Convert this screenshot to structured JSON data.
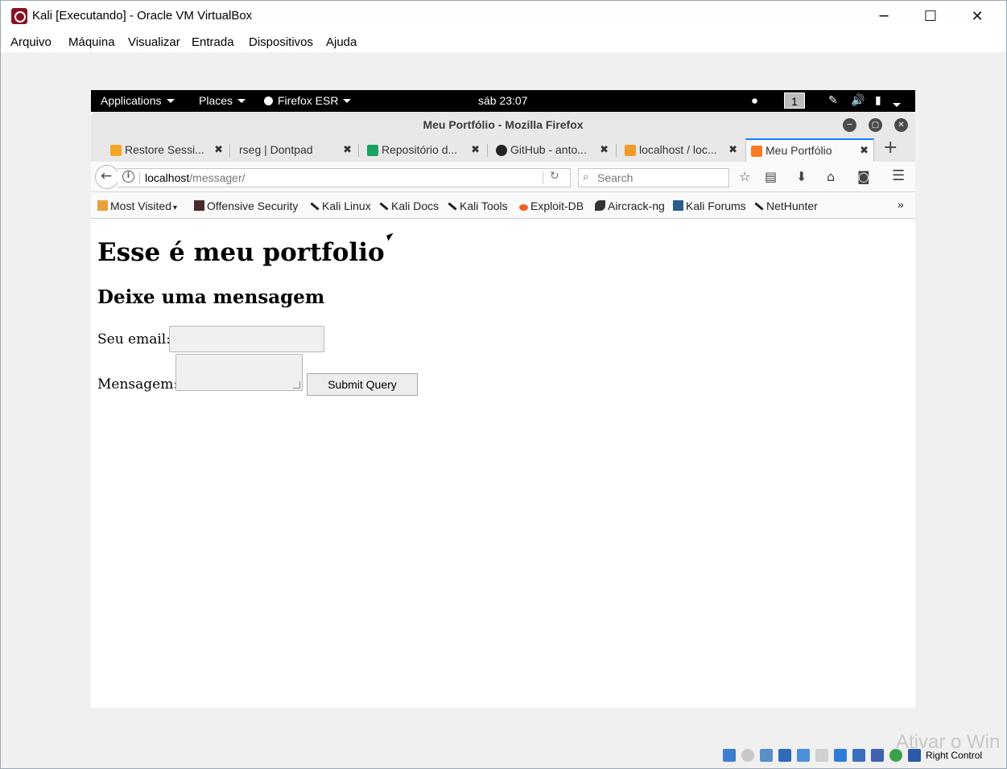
{
  "vbox": {
    "title": "Kali [Executando] - Oracle VM VirtualBox",
    "minimize": "─",
    "maximize": "☐",
    "close": "✕",
    "menu": [
      "Arquivo",
      "Máquina",
      "Visualizar",
      "Entrada",
      "Dispositivos",
      "Ajuda"
    ],
    "status_host_key": "Right Control",
    "watermark": "Ativar o Win"
  },
  "gnome": {
    "applications": "Applications",
    "places": "Places",
    "firefox": "Firefox ESR",
    "clock": "sáb 23:07",
    "workspace": "1"
  },
  "firefox": {
    "window_title": "Meu Portfólio - Mozilla Firefox",
    "tabs": [
      {
        "label": "Restore Sessi...",
        "icon_color": "#f5a623"
      },
      {
        "label": "rseg | Dontpad",
        "icon_color": ""
      },
      {
        "label": "Repositório d...",
        "icon_color": "#1aa260"
      },
      {
        "label": "GitHub - anto...",
        "icon_color": "#222222"
      },
      {
        "label": "localhost / loc...",
        "icon_color": "#f09a2b"
      },
      {
        "label": "Meu Portfólio",
        "icon_color": "#fb7a24"
      }
    ],
    "url_host": "localhost",
    "url_path": "/messager/",
    "search_placeholder": "Search",
    "bookmarks": [
      {
        "label": "Most Visited",
        "icon_color": "#e9a03b"
      },
      {
        "label": "Offensive Security",
        "icon_color": "#4a2b2b"
      },
      {
        "label": "Kali Linux",
        "icon_color": "#222"
      },
      {
        "label": "Kali Docs",
        "icon_color": "#222"
      },
      {
        "label": "Kali Tools",
        "icon_color": "#222"
      },
      {
        "label": "Exploit-DB",
        "icon_color": "#f06022"
      },
      {
        "label": "Aircrack-ng",
        "icon_color": "#333"
      },
      {
        "label": "Kali Forums",
        "icon_color": "#2b5d8c"
      },
      {
        "label": "NetHunter",
        "icon_color": "#222"
      }
    ],
    "bookmarks_overflow": "»"
  },
  "page": {
    "heading": "Esse é meu portfolio",
    "subheading": "Deixe uma mensagem",
    "email_label": "Seu email:",
    "email_value": "",
    "message_label": "Mensagem:",
    "message_value": "",
    "submit_label": "Submit Query"
  },
  "colors": {
    "accent": "#0a84ff",
    "gnome_bar": "#000000",
    "vbox_bg": "#f0f0f0"
  }
}
